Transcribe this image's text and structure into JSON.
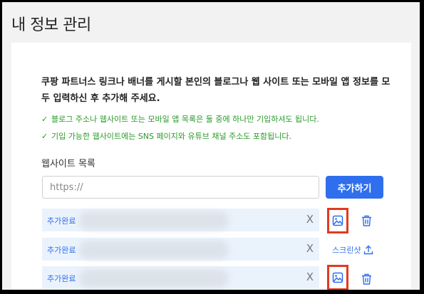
{
  "title": "내 정보 관리",
  "intro": "쿠팡 파트너스 링크나 배너를 게시할 본인의 블로그나 웹 사이트 또는 모바일 앱 정보를 모두 입력하신 후 추가해 주세요.",
  "checks": [
    "블로그 주소나 웹사이트 또는 모바일 앱 목록은 둘 중에 하나만 기입하셔도 됩니다.",
    "기입 가능한 웹사이트에는 SNS 페이지와 유튜브 채널 주소도 포함됩니다."
  ],
  "check_mark": "✓",
  "website_section": {
    "label": "웹사이트 목록",
    "input_placeholder": "https://",
    "add_button": "추가하기"
  },
  "rows": [
    {
      "status": "추가완료",
      "remove": "X"
    },
    {
      "status": "추가완료",
      "remove": "X"
    },
    {
      "status": "추가완료",
      "remove": "X"
    }
  ],
  "screenshot_label": "스크린샷",
  "colors": {
    "accent": "#2f6fed",
    "check_green": "#2a9a2a",
    "highlight_red": "#e23a1f",
    "row_bg": "#eaf2fc"
  },
  "icons": [
    "image-icon",
    "trash-icon",
    "upload-icon"
  ]
}
